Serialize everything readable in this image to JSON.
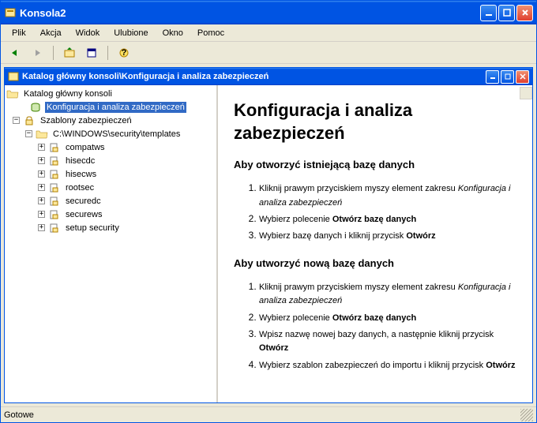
{
  "window": {
    "title": "Konsola2"
  },
  "menu": {
    "items": [
      "Plik",
      "Akcja",
      "Widok",
      "Ulubione",
      "Okno",
      "Pomoc"
    ]
  },
  "child": {
    "title": "Katalog główny konsoli\\Konfiguracja i analiza zabezpieczeń"
  },
  "tree": {
    "root": "Katalog główny konsoli",
    "config": "Konfiguracja i analiza zabezpieczeń",
    "templates": "Szablony zabezpieczeń",
    "path": "C:\\WINDOWS\\security\\templates",
    "items": [
      "compatws",
      "hisecdc",
      "hisecws",
      "rootsec",
      "securedc",
      "securews",
      "setup security"
    ]
  },
  "content": {
    "h1": "Konfiguracja i analiza zabezpieczeń",
    "h2a": "Aby otworzyć istniejącą bazę danych",
    "listA": {
      "i1a": "Kliknij prawym przyciskiem myszy element zakresu ",
      "i1b": "Konfiguracja i analiza zabezpieczeń",
      "i2a": "Wybierz polecenie ",
      "i2b": "Otwórz bazę danych",
      "i3a": "Wybierz bazę danych i kliknij przycisk ",
      "i3b": "Otwórz"
    },
    "h2b": "Aby utworzyć nową bazę danych",
    "listB": {
      "i1a": "Kliknij prawym przyciskiem myszy element zakresu ",
      "i1b": "Konfiguracja i analiza zabezpieczeń",
      "i2a": "Wybierz polecenie ",
      "i2b": "Otwórz bazę danych",
      "i3a": "Wpisz nazwę nowej bazy danych, a następnie kliknij przycisk ",
      "i3b": "Otwórz",
      "i4a": "Wybierz szablon zabezpieczeń do importu i kliknij przycisk ",
      "i4b": "Otwórz"
    }
  },
  "status": "Gotowe"
}
